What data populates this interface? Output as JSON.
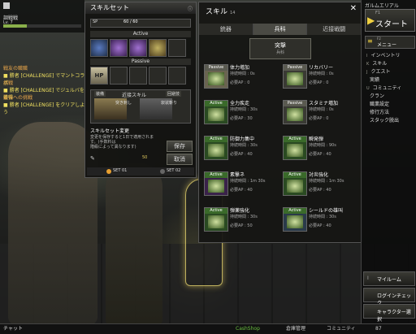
{
  "hud": {
    "chat_tab": "調戦戦",
    "level": "Lv. 7",
    "chat_lines": [
      {
        "head": "戦友の職職",
        "text": "■ 勝者 [CHALLENGE] でマントコラボ"
      },
      {
        "head": "挑戦",
        "text": "■ 勝者 [CHALLENGE] でジュルバを獲得"
      },
      {
        "head": "最強への挑戦",
        "text": "■ 勝者 [CHALLENGE] をクリアしよう"
      }
    ]
  },
  "skillset": {
    "title": "スキルセット",
    "sp_label": "SP",
    "sp_value": "60 / 60",
    "active_label": "Active",
    "passive_label": "Passive",
    "hp_slot": "HP",
    "weapon_label": "装備",
    "skill_label": "近接スキル",
    "skill_tag": "回避技",
    "skill_name1": "突き刺し",
    "skill_name2": "袈裟斬り",
    "change_title": "スキルセット変更",
    "change_desc": "変更を保存すると1日で適用されます。(手数料は",
    "change_desc2": "階級によって異なります)",
    "save_btn": "保存",
    "cancel_btn": "取消",
    "cost": "50",
    "set1": "SET 01",
    "set2": "SET 02"
  },
  "skills": {
    "title": "スキル",
    "count": "14",
    "tabs": [
      "銃器",
      "兵科",
      "近接戦闘"
    ],
    "header_name": "突撃",
    "header_sub": "兵科",
    "cards": [
      {
        "tag": "Passive",
        "name": "体力増加",
        "l1": "持続時間 : 0s",
        "l2": "必要AP : 0"
      },
      {
        "tag": "Passive",
        "name": "リカバリー",
        "l1": "持続時間 : 0s",
        "l2": "必要AP : 0"
      },
      {
        "tag": "Active",
        "name": "全力疾走",
        "l1": "持続時間 : 30s",
        "l2": "必要AP : 30"
      },
      {
        "tag": "Passive",
        "name": "スタミナ増加",
        "l1": "持続時間 : 0s",
        "l2": "必要AP : 0"
      },
      {
        "tag": "Active",
        "name": "防御力集中",
        "l1": "持続時間 : 30s",
        "l2": "必要AP : 40"
      },
      {
        "tag": "Active",
        "name": "瞬発弾",
        "l1": "持続時間 : 90s",
        "l2": "必要AP : 40"
      },
      {
        "tag": "Active",
        "name": "素撃ネ",
        "l1": "持続時間 : 1m 30s",
        "l2": "必要AP : 40"
      },
      {
        "tag": "Active",
        "name": "対炎強化",
        "l1": "持続時間 : 1m 30s",
        "l2": "必要AP : 40"
      },
      {
        "tag": "Active",
        "name": "弾薬強化",
        "l1": "持続時間 : 30s",
        "l2": "必要AP : 50"
      },
      {
        "tag": "Active",
        "name": "シールドの雄叫",
        "l1": "持続時間 : 30s",
        "l2": "必要AP : 40"
      }
    ]
  },
  "menu": {
    "user": "ガルムエリアル",
    "start_key": "F1",
    "start_label": "スタート",
    "menu_key": "F2",
    "menu_label": "メニュー",
    "items": [
      {
        "key": "I",
        "label": "インベントリ"
      },
      {
        "key": "K",
        "label": "スキル"
      },
      {
        "key": "J",
        "label": "クエスト"
      },
      {
        "key": "",
        "label": "実績"
      },
      {
        "key": "U",
        "label": "コミュニティ"
      },
      {
        "key": "",
        "label": "クラン"
      },
      {
        "key": "",
        "label": "職業設定"
      },
      {
        "key": "",
        "label": "修行方法"
      },
      {
        "key": "",
        "label": "スタック脱出"
      }
    ],
    "bottom_items": [
      {
        "key": "I",
        "label": "マイルーム"
      },
      {
        "key": "",
        "label": "ログインチェック"
      },
      {
        "key": "",
        "label": "キャラクター選択"
      }
    ]
  },
  "bottombar": {
    "chat": "チャット",
    "cashshop": "CashShop",
    "storage": "倉庫管理",
    "community": "コミュニティ",
    "points": "87"
  }
}
